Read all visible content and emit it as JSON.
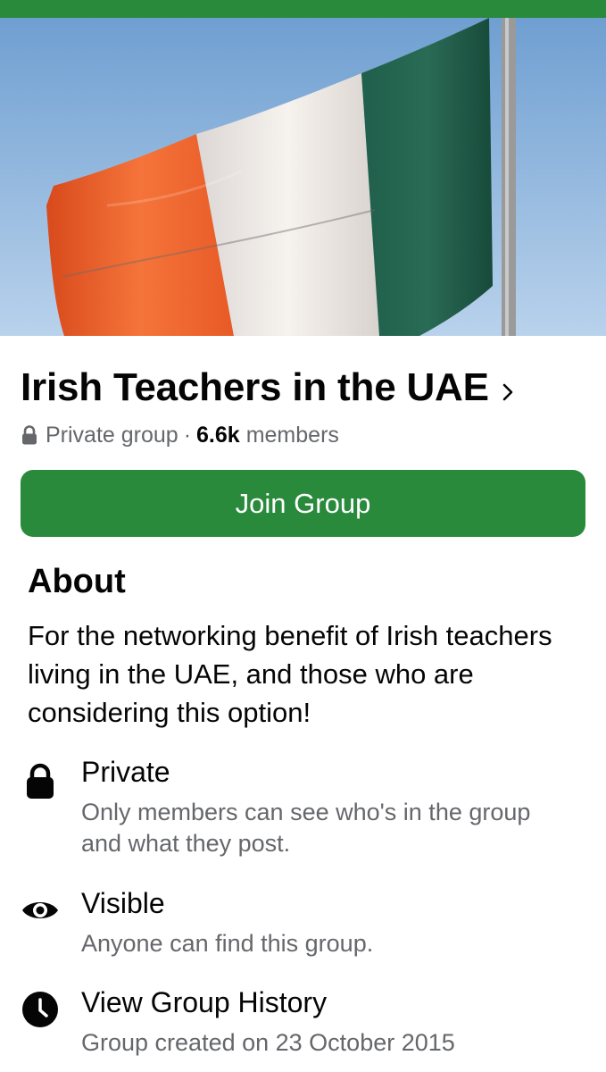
{
  "group": {
    "name": "Irish Teachers in the UAE",
    "privacy": "Private group",
    "separator": "·",
    "member_count": "6.6k",
    "members_label": "members"
  },
  "join_button_label": "Join Group",
  "about": {
    "heading": "About",
    "description": "For the networking benefit of Irish teachers living in the UAE, and those who are considering this option!"
  },
  "info_items": [
    {
      "icon": "lock-icon",
      "title": "Private",
      "subtitle": "Only members can see who's in the group and what they post."
    },
    {
      "icon": "eye-icon",
      "title": "Visible",
      "subtitle": "Anyone can find this group."
    },
    {
      "icon": "clock-icon",
      "title": "View Group History",
      "subtitle": "Group created on 23 October 2015"
    }
  ],
  "colors": {
    "accent_green": "#2a8a3c",
    "flag_orange": "#f0642c",
    "flag_white": "#f2ede9",
    "flag_green": "#1c5a47",
    "sky": "#8fb7e0"
  }
}
